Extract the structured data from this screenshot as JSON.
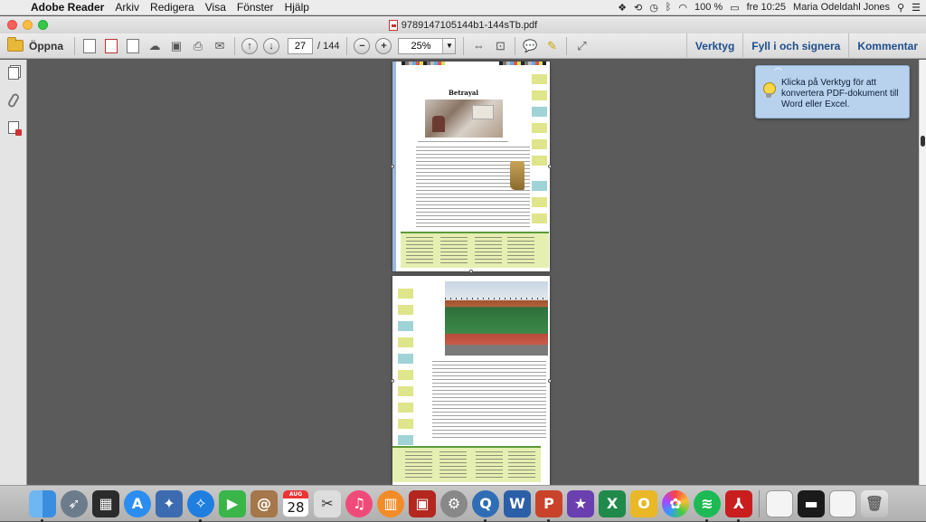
{
  "menubar": {
    "app_name": "Adobe Reader",
    "items": [
      "Arkiv",
      "Redigera",
      "Visa",
      "Fönster",
      "Hjälp"
    ],
    "battery": "100 %",
    "clock": "fre 10:25",
    "user": "Maria Odeldahl Jones"
  },
  "window": {
    "title": "9789147105144b1-144sTb.pdf"
  },
  "toolbar": {
    "open_label": "Öppna",
    "page_current": "27",
    "page_total": "/ 144",
    "zoom": "25%",
    "tools_label": "Verktyg",
    "fill_sign_label": "Fyll i och signera",
    "comment_label": "Kommentar"
  },
  "document": {
    "page1_heading": "Betrayal"
  },
  "tooltip": {
    "text": "Klicka på Verktyg för att konvertera PDF-dokument till Word eller Excel."
  },
  "dock": {
    "calendar_month": "AUG",
    "calendar_day": "28",
    "apps": [
      "finder-icon",
      "launchpad-icon",
      "mission-control-icon",
      "app-store-icon",
      "preview-icon",
      "safari-icon",
      "facetime-icon",
      "contacts-icon",
      "calendar-icon",
      "scissors-icon",
      "itunes-icon",
      "ibooks-icon",
      "photo-booth-icon",
      "system-preferences-icon",
      "quicktime-icon",
      "word-icon",
      "powerpoint-icon",
      "imovie-icon",
      "excel-icon",
      "outlook-icon",
      "photos-icon",
      "spotify-icon",
      "acrobat-icon",
      "document-icon",
      "terminal-icon",
      "screenshot-icon",
      "trash-icon"
    ]
  },
  "colors": {
    "accent_link": "#1f4e8c",
    "tooltip_bg": "#b8d2ee",
    "vocab_bg": "#e6efb2"
  }
}
